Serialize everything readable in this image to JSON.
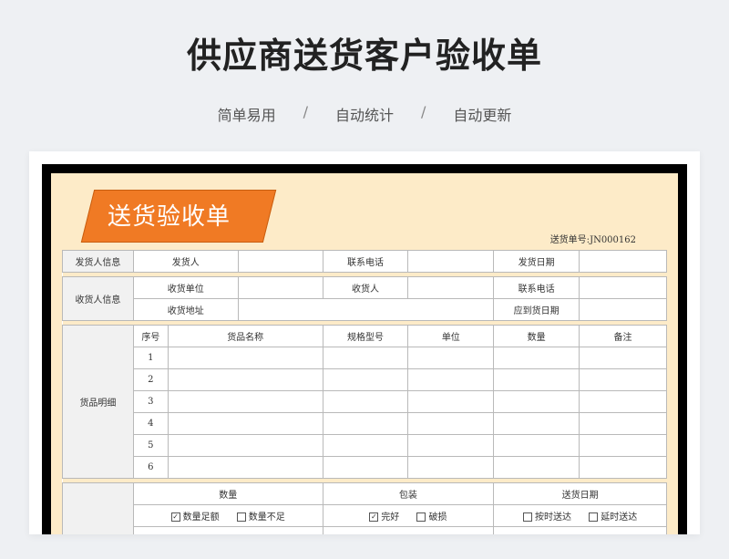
{
  "header": {
    "title": "供应商送货客户验收单",
    "tagline": [
      "简单易用",
      "自动统计",
      "自动更新"
    ],
    "separator": "/"
  },
  "form": {
    "banner": "送货验收单",
    "order_label": "送货单号:",
    "order_no": "JN000162",
    "sender_info": {
      "section": "发货人信息",
      "sender_label": "发货人",
      "phone_label": "联系电话",
      "date_label": "发货日期"
    },
    "receiver_info": {
      "section": "收货人信息",
      "unit_label": "收货单位",
      "receiver_label": "收货人",
      "phone_label": "联系电话",
      "address_label": "收货地址",
      "due_label": "应到货日期"
    },
    "goods": {
      "section": "货品明细",
      "columns": [
        "序号",
        "货品名称",
        "规格型号",
        "单位",
        "数量",
        "备注"
      ],
      "rows": [
        "1",
        "2",
        "3",
        "4",
        "5",
        "6"
      ]
    },
    "check": {
      "groups": [
        {
          "title": "数量",
          "options": [
            {
              "label": "数量足额",
              "checked": true
            },
            {
              "label": "数量不足",
              "checked": false
            }
          ]
        },
        {
          "title": "包装",
          "options": [
            {
              "label": "完好",
              "checked": true
            },
            {
              "label": "破损",
              "checked": false
            }
          ]
        },
        {
          "title": "送货日期",
          "options": [
            {
              "label": "按时送达",
              "checked": false
            },
            {
              "label": "延时送达",
              "checked": false
            }
          ]
        }
      ]
    }
  }
}
